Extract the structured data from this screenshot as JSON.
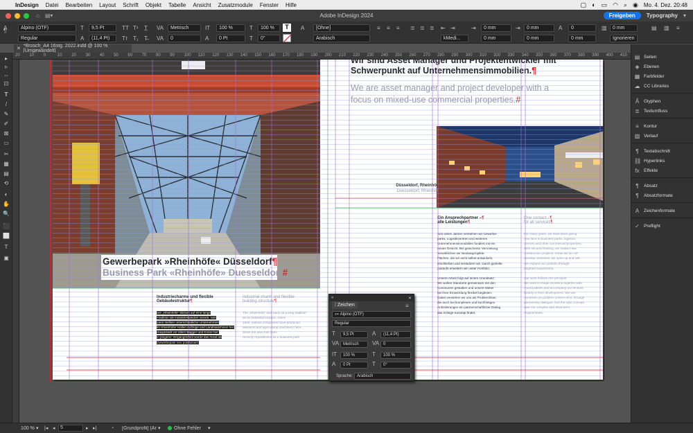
{
  "menubar": {
    "app": "InDesign",
    "items": [
      "Datei",
      "Bearbeiten",
      "Layout",
      "Schrift",
      "Objekt",
      "Tabelle",
      "Ansicht",
      "Zusatzmodule",
      "Fenster",
      "Hilfe"
    ],
    "clock": "Mo. 4. Dez. 20:48"
  },
  "window": {
    "title": "Adobe InDesign 2024",
    "share_label": "Freigeben",
    "workspace": "Typography"
  },
  "control": {
    "font": "Alpino (OTF)",
    "style": "Regular",
    "size": "9,5 Pt",
    "leading": "(11,4 Pt)",
    "kerning": "Metrisch",
    "tracking": "0",
    "vscale": "100 %",
    "hscale": "100 %",
    "baseline": "0 Pt",
    "skew": "0°",
    "char_style": "[Ohne]",
    "language": "Arabisch",
    "kashida": "kMedi...",
    "indent_values": [
      "0 mm",
      "0 mm",
      "0 mm",
      "0 mm",
      "0 mm",
      "0 mm",
      "0 mm",
      "0 mm"
    ],
    "ignore": "Ignorieren"
  },
  "doctab": {
    "label": "*Brosch_A4 16stg. 2022.indd @ 100 % [Umgewandelt]"
  },
  "ruler": {
    "ticks": [
      "20",
      "10",
      "0",
      "10",
      "20",
      "30",
      "40",
      "50",
      "60",
      "70",
      "80",
      "90",
      "100",
      "110",
      "120",
      "130",
      "140",
      "150",
      "160",
      "170",
      "180",
      "190",
      "200",
      "210",
      "220",
      "230",
      "240",
      "250",
      "260",
      "270",
      "280",
      "290",
      "300",
      "310",
      "320",
      "330",
      "340",
      "350",
      "360",
      "370",
      "380",
      "390",
      "400",
      "410",
      "420"
    ]
  },
  "document": {
    "left_head_de": "Gewerbepark »Rheinhöfe« Düsseldorf",
    "left_head_en": "Business Park «Rheinhöfe» Duesseldorf",
    "right_head_top": "Wir sind Asset Manager und Projektentwickler mit",
    "right_head_de": "Schwerpunkt auf Unternehmensimmobilien.",
    "right_head_en1": "We are asset manager and project developer with a",
    "right_head_en2": "focus on mixed-use commercial properties.",
    "caption_de": "Düsseldorf, Rheinhöf",
    "caption_en": "Duesseldorf, Rheinhöf",
    "sub_de1": "Industriecharme und flexible",
    "sub_de2": "Gebäudestruktur",
    "sub_en1": "Industrial charm and flexible",
    "sub_en2": "building structure",
    "left_body": [
      "Die „Rheinhöfe“ blicken auf eine lange",
      "Tradition als Industriestandort zurück. Seit",
      "1900 stellten unterschiedliche Unternehmen",
      "im Rheinhöfer Hallen Aufzüge und Landmaschinen her.",
      "Hauptstadt vor allem Bagger und Kräne her.",
      "In jüngerer Vergangenheit wurde das Areal als",
      "Gewerbepark neu positioniert."
    ],
    "left_body_en": [
      "The „Rheinhöfe“ look back on a long tradition",
      "as an industrial location. Since",
      "1900, various companies have produced",
      "elevators and agricultural machinery here.",
      "Since the area has been",
      "recently repositioned as a business park."
    ],
    "contact_de1": "Ein Ansprechpartner –",
    "contact_de2": "alle Leistungen",
    "contact_en1": "One contact –",
    "contact_en2": "for all services",
    "mid_body": [
      "Seit vielen Jahren verstehen wir Gewerbe-",
      "parks, Logistikzentren und weiteren",
      "Unternehmensimmobilien fundiert mit ein",
      "neues Gesicht. Bei gesicherter Vermietung",
      "verwirklichen wir Neubauprojekte.",
      "Flächen, die wir nicht selbst entwickeln,",
      "erschließen und veräußern wir. Durch gezielte",
      "Zukäufe erweitern wir unser Portfolio.",
      "",
      "Unsere Arbeit folgt auf einem Grundsatz:",
      "Wir wollen Standorte gemeinsam mit den",
      "Kommunen gestalten und unsere Mieter",
      "bei ihrer Entwicklung flexibel begleiten.",
      "Dabei verstehen wir uns als Problemlöser,",
      "die auch bei komplexen und kurzfristigen",
      "Anforderungen ein partnerschaftlicher Dialog",
      "das richtige Konzept findet."
    ],
    "right_body": [
      "For many years, we have been giving",
      "new face to business parks, logistics",
      "centres and other commercial properties.",
      "With secured leasing, we realise new",
      "construction projects. Areas we do not",
      "develop ourselves, we open up and sell.",
      "We expand our portfolio through",
      "targeted acquisitions.",
      "",
      "Our work follows one principle:",
      "We want to shape locations together with",
      "municipalities and accompany our tenants",
      "flexibly in their development. We see",
      "ourselves as problem solvers who, through",
      "partnership dialogue, find the right concept",
      "even for complex and short-term",
      "requirements."
    ]
  },
  "tools": [
    "▸",
    "▹",
    "⇔",
    "⊡",
    "T",
    "/",
    "✎",
    "✐",
    "⊠",
    "▭",
    "✂",
    "▦",
    "▤",
    "⟲",
    "◐",
    "✋",
    "🔍",
    "⬛",
    "⬜",
    "T",
    "▣"
  ],
  "panels": {
    "items": [
      {
        "label": "Seiten",
        "icon": "pages-icon",
        "glyph": "▤"
      },
      {
        "label": "Ebenen",
        "icon": "layers-icon",
        "glyph": "◈"
      },
      {
        "label": "Farbfelder",
        "icon": "swatches-icon",
        "glyph": "▦"
      },
      {
        "label": "CC Libraries",
        "icon": "libraries-icon",
        "glyph": "☁"
      },
      {
        "label": "Glyphen",
        "icon": "glyphs-icon",
        "glyph": "Å"
      },
      {
        "label": "Textumfluss",
        "icon": "text-wrap-icon",
        "glyph": "≣"
      },
      {
        "label": "Kontur",
        "icon": "stroke-icon",
        "glyph": "≡"
      },
      {
        "label": "Verlauf",
        "icon": "gradient-icon",
        "glyph": "▨"
      },
      {
        "label": "Textabschnitt",
        "icon": "story-icon",
        "glyph": "¶"
      },
      {
        "label": "Hyperlinks",
        "icon": "hyperlinks-icon",
        "glyph": "⛓"
      },
      {
        "label": "Effekte",
        "icon": "effects-icon",
        "glyph": "fx"
      },
      {
        "label": "Absatz",
        "icon": "paragraph-icon",
        "glyph": "¶"
      },
      {
        "label": "Absatzformate",
        "icon": "paragraph-styles-icon",
        "glyph": "¶"
      },
      {
        "label": "Zeichenformate",
        "icon": "character-styles-icon",
        "glyph": "A"
      },
      {
        "label": "Preflight",
        "icon": "preflight-icon",
        "glyph": "✓"
      }
    ]
  },
  "char_panel": {
    "title": "Zeichen",
    "font": "Alpino (OTF)",
    "style": "Regular",
    "size": "9,5 Pt",
    "leading": "(11,4 Pt)",
    "kerning": "Metrisch",
    "tracking": "0",
    "vscale": "100 %",
    "hscale": "100 %",
    "baseline": "0 Pt",
    "skew": "0°",
    "lang_label": "Sprache:",
    "lang": "Arabisch"
  },
  "status": {
    "zoom": "100 %",
    "page": "5",
    "profile": "[Grundprofil] (Ar...",
    "errors": "Ohne Fehler"
  }
}
